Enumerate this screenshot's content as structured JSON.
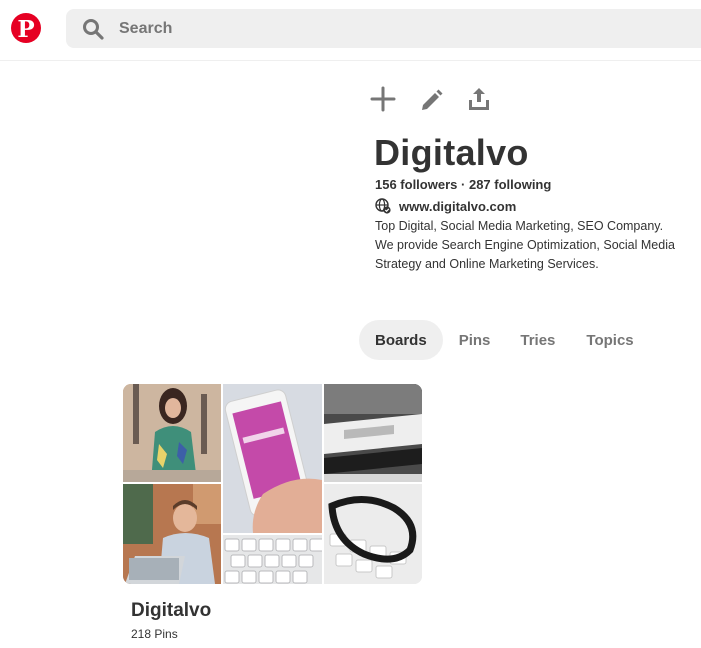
{
  "header": {
    "logo_icon": "pinterest-logo-icon",
    "search": {
      "icon": "search-icon",
      "placeholder": "Search",
      "value": ""
    }
  },
  "profile": {
    "actions": [
      {
        "icon": "plus-icon"
      },
      {
        "icon": "pencil-icon"
      },
      {
        "icon": "share-icon"
      }
    ],
    "name": "Digitalvo",
    "followers": "156 followers",
    "separator": "·",
    "following": "287 following",
    "website": {
      "icon": "globe-icon",
      "url": "www.digitalvo.com"
    },
    "bio": "Top Digital, Social Media Marketing, SEO Company. We provide Search Engine Optimization, Social Media Strategy and Online Marketing Services."
  },
  "tabs": [
    {
      "label": "Boards",
      "active": true
    },
    {
      "label": "Pins",
      "active": false
    },
    {
      "label": "Tries",
      "active": false
    },
    {
      "label": "Topics",
      "active": false
    }
  ],
  "boards": [
    {
      "title": "Digitalvo",
      "pins": "218 Pins"
    }
  ],
  "colors": {
    "brand": "#e60023",
    "text": "#333333",
    "muted": "#767676",
    "chip": "#efefef"
  }
}
